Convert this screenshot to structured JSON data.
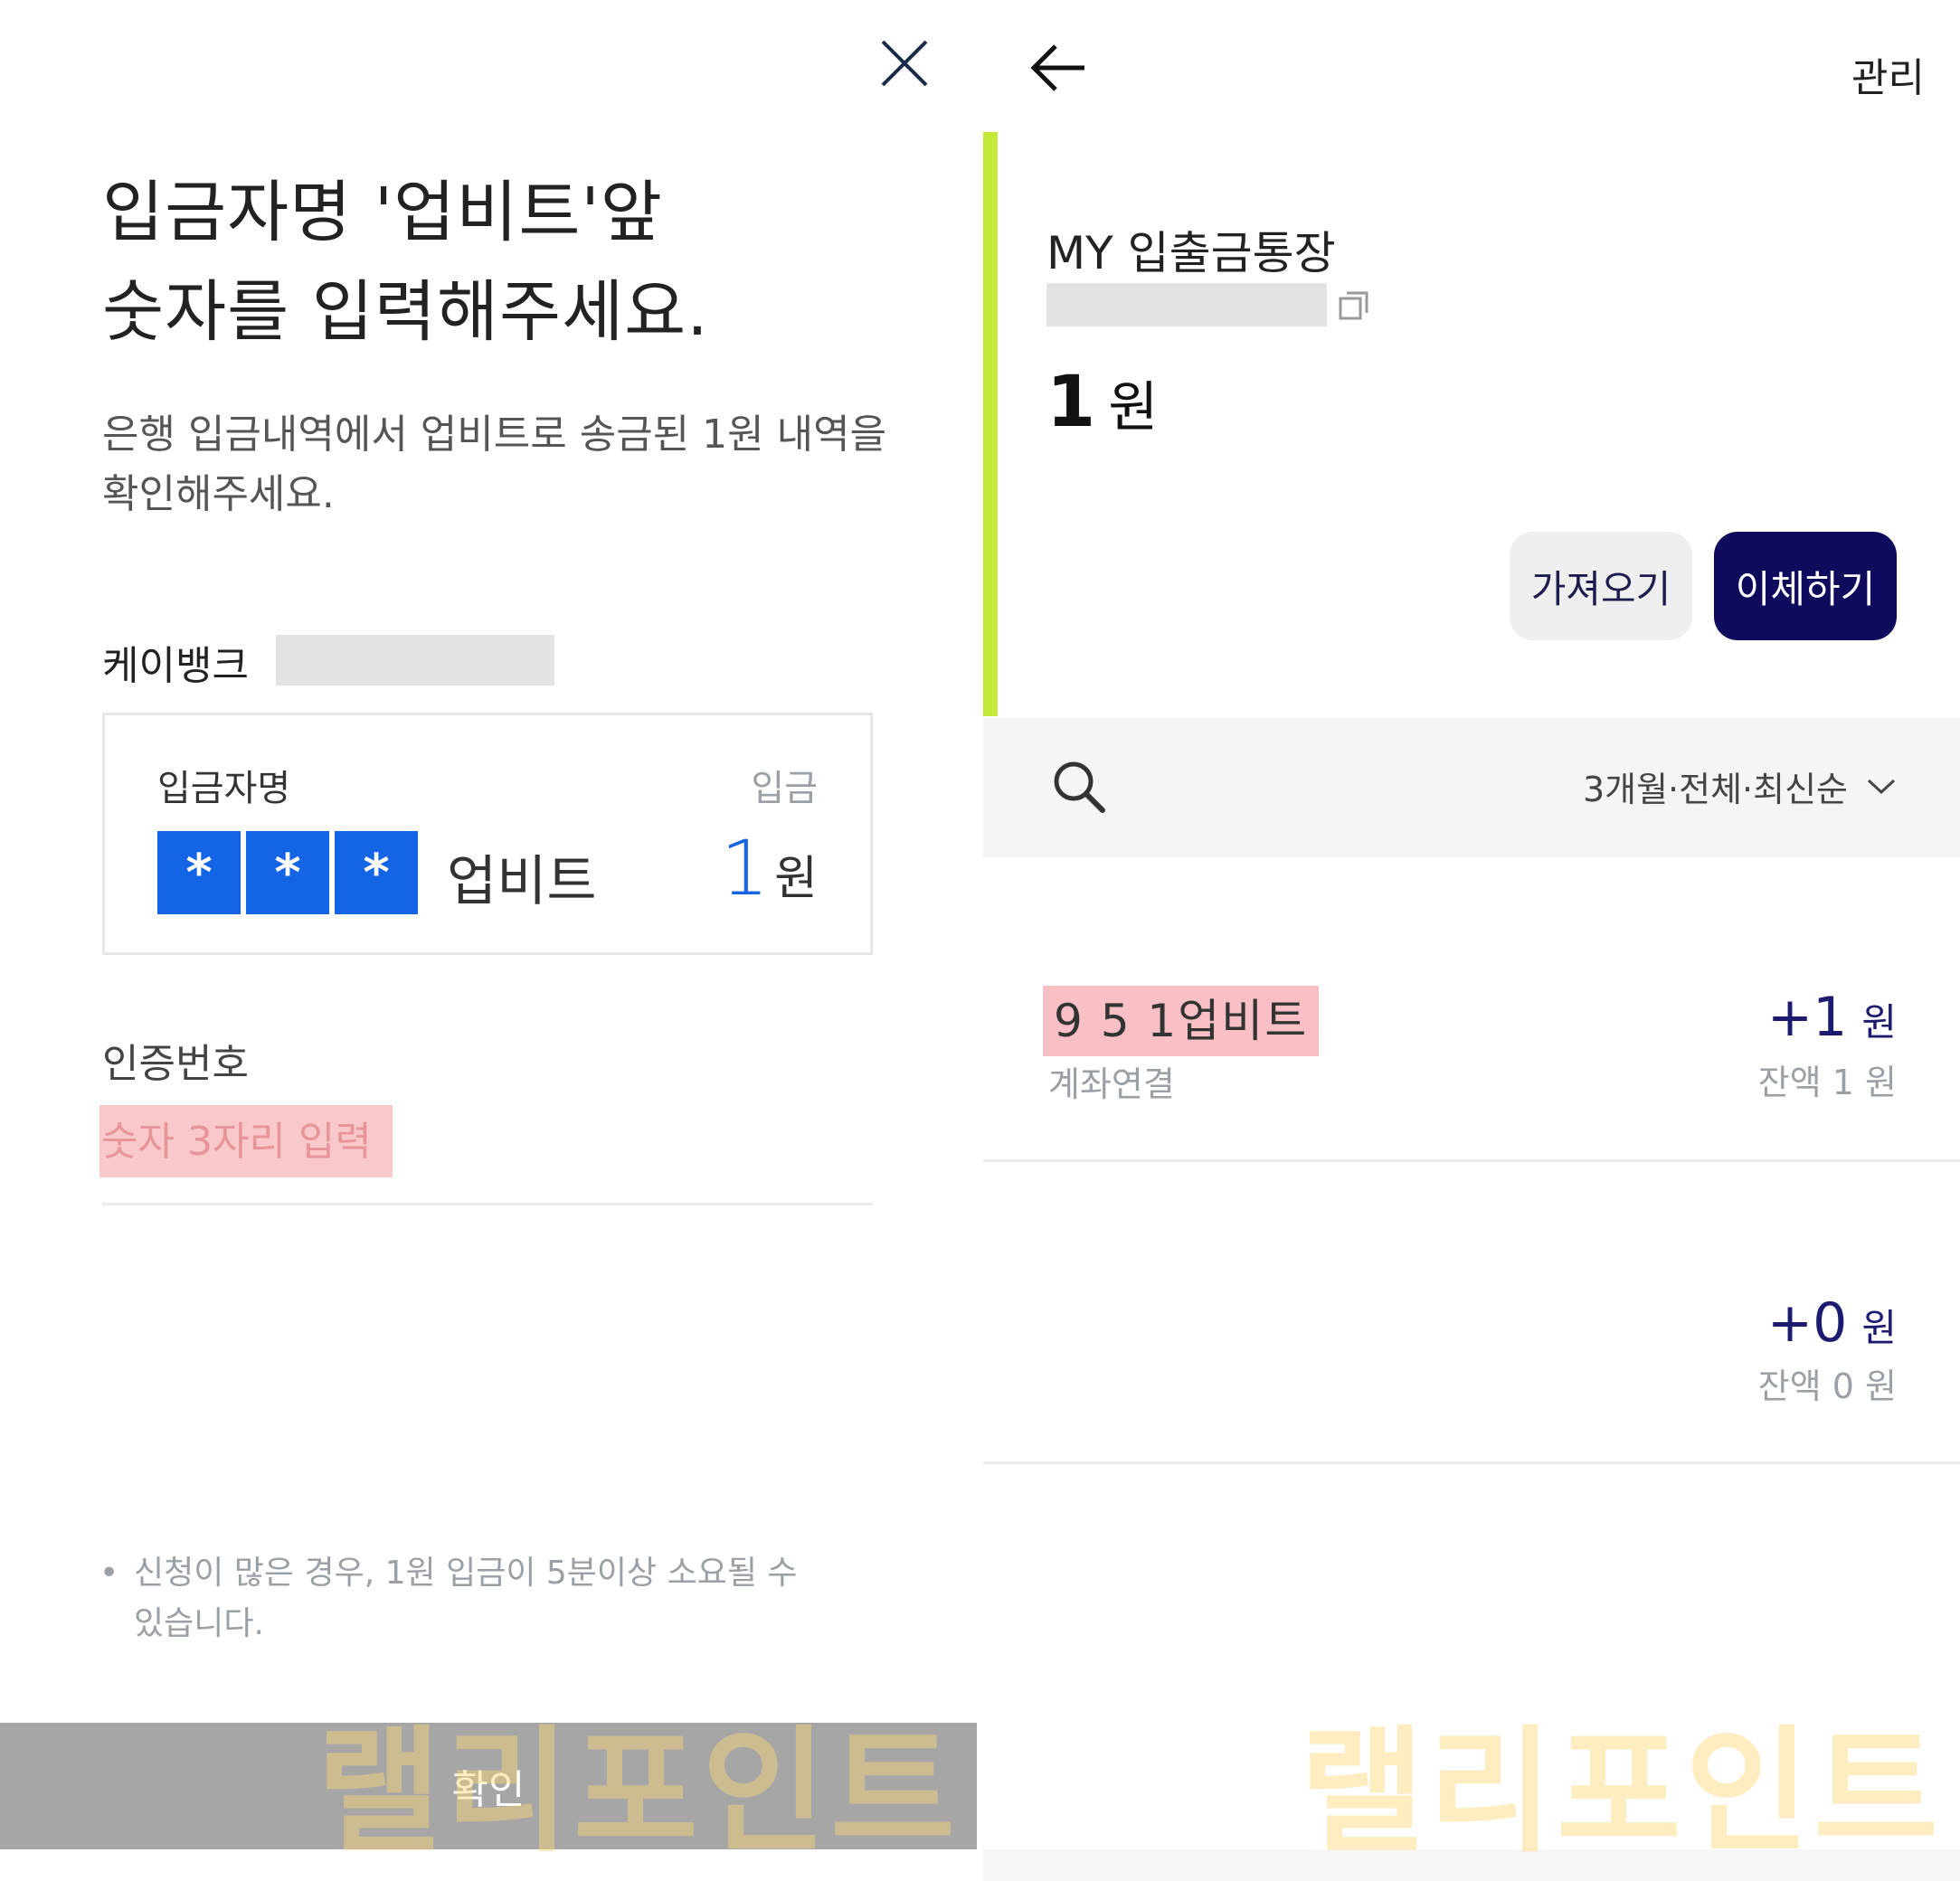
{
  "left": {
    "title_line1": "입금자명 '업비트'앞",
    "title_line2": "숫자를 입력해주세요.",
    "description": "은행 입금내역에서 업비트로 송금된 1원 내역을 확인해주세요.",
    "bank_name": "케이뱅크",
    "card": {
      "depositor_label": "입금자명",
      "deposit_label": "입금",
      "mask_chars": [
        "*",
        "*",
        "*"
      ],
      "sender": "업비트",
      "amount": "1",
      "amount_unit": "원"
    },
    "auth_label": "인증번호",
    "auth_placeholder": "숫자 3자리 입력",
    "notice_bullet": "•",
    "notice": "신청이 많은 경우, 1원 입금이 5분이상 소요될 수 있습니다.",
    "confirm_label": "확인"
  },
  "right": {
    "manage_label": "관리",
    "account_name": "MY 입출금통장",
    "balance_value": "1",
    "balance_unit": "원",
    "btn_get_label": "가져오기",
    "btn_transfer_label": "이체하기",
    "filter_label": "3개월·전체·최신순",
    "transactions": [
      {
        "title": "9 5 1업비트",
        "subtitle": "계좌연결",
        "amount": "+1",
        "unit": "원",
        "balance": "잔액 1 원"
      },
      {
        "title": "",
        "subtitle": "",
        "amount": "+0",
        "unit": "원",
        "balance": "잔액 0 원"
      }
    ]
  },
  "watermark": "랠리포인트",
  "colors": {
    "accent_blue": "#1464e6",
    "navy": "#0e0a5c",
    "lime_bar": "#c4ea37",
    "highlight_pink": "#f8c0c4",
    "confirm_gray": "#a6a6a6"
  }
}
